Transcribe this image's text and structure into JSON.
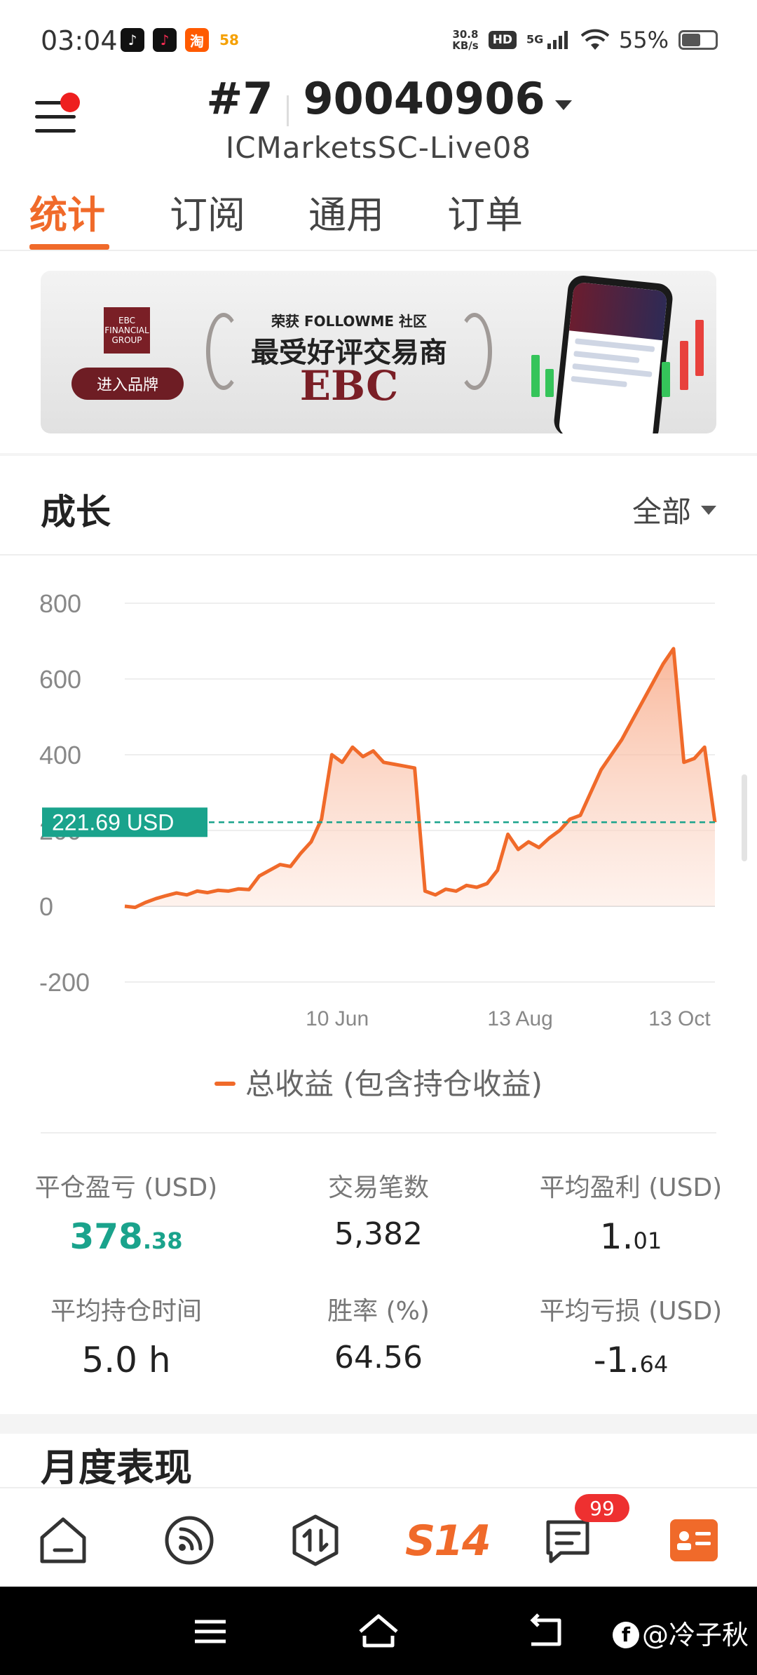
{
  "status_bar": {
    "time": "03:04",
    "apps": [
      {
        "icon": "tiktok-icon",
        "label": "♪",
        "color": "#111111"
      },
      {
        "icon": "tiktok-lite-icon",
        "label": "♪",
        "color": "#c8102e"
      },
      {
        "icon": "taobao-icon",
        "label": "淘",
        "color": "#ff5a00"
      },
      {
        "icon": "58-icon",
        "label": "58",
        "color": "#ffffff"
      }
    ],
    "net_speed_value": "30.8",
    "net_speed_unit": "KB/s",
    "hd_label": "HD",
    "network": "5G",
    "battery": "55%"
  },
  "header": {
    "account_rank": "#7",
    "account_number": "90040906",
    "server": "ICMarketsSC-Live08"
  },
  "tabs": [
    {
      "label": "统计",
      "active": true
    },
    {
      "label": "订阅",
      "active": false
    },
    {
      "label": "通用",
      "active": false
    },
    {
      "label": "订单",
      "active": false
    }
  ],
  "banner": {
    "logo_text": "EBC FINANCIAL GROUP",
    "enter_label": "进入品牌",
    "award_sub": "荣获 FOLLOWME 社区",
    "award_main": "最受好评交易商",
    "brand": "EBC"
  },
  "growth": {
    "title": "成长",
    "filter": "全部",
    "current_value_label": "221.69 USD",
    "legend": "总收益 (包含持仓收益)"
  },
  "chart_data": {
    "type": "area",
    "series": [
      {
        "name": "总收益 (包含持仓收益)",
        "color": "#f06a2a",
        "values": [
          0,
          -3,
          10,
          20,
          28,
          35,
          30,
          40,
          36,
          42,
          40,
          46,
          44,
          80,
          95,
          110,
          105,
          140,
          170,
          230,
          400,
          380,
          420,
          395,
          410,
          380,
          375,
          370,
          365,
          40,
          30,
          45,
          40,
          55,
          50,
          60,
          95,
          190,
          150,
          170,
          155,
          180,
          200,
          230,
          240,
          300,
          360,
          400,
          440,
          490,
          540,
          590,
          640,
          680,
          380,
          390,
          420,
          221.69
        ]
      }
    ],
    "x_tick_labels": [
      "10 Jun",
      "13 Aug",
      "13 Oct"
    ],
    "y_ticks": [
      800,
      600,
      400,
      200,
      0,
      -200
    ],
    "ylim": [
      -200,
      800
    ],
    "current_value": 221.69,
    "grid": true
  },
  "stats": [
    {
      "label": "平仓盈亏 (USD)",
      "int": "378",
      "frac": ".38",
      "green": true
    },
    {
      "label": "交易笔数",
      "int": "5,382",
      "frac": "",
      "green": false
    },
    {
      "label": "平均盈利 (USD)",
      "int": "1.",
      "frac": "01",
      "green": false
    },
    {
      "label": "平均持仓时间",
      "int": "5.0 h",
      "frac": "",
      "green": false
    },
    {
      "label": "胜率 (%)",
      "int": "64.56",
      "frac": "",
      "green": false
    },
    {
      "label": "平均亏损 (USD)",
      "int": "-1.",
      "frac": "64",
      "green": false
    }
  ],
  "monthly": {
    "title": "月度表现"
  },
  "bottom_nav": {
    "s14_label": "S14",
    "messages_badge": "99"
  },
  "watermark": "@冷子秋"
}
